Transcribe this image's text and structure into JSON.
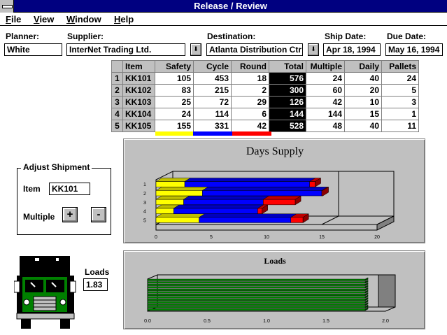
{
  "window": {
    "title": "Release / Review"
  },
  "menu": [
    "File",
    "View",
    "Window",
    "Help"
  ],
  "form": {
    "planner_label": "Planner:",
    "planner_value": "White",
    "supplier_label": "Supplier:",
    "supplier_value": "InterNet Trading Ltd.",
    "destination_label": "Destination:",
    "destination_value": "Atlanta Distribution Ctr",
    "ship_date_label": "Ship Date:",
    "ship_date_value": "Apr 18, 1994",
    "due_date_label": "Due Date:",
    "due_date_value": "May 16, 1994"
  },
  "table": {
    "columns": [
      "Item",
      "Safety",
      "Cycle",
      "Round",
      "Total",
      "Multiple",
      "Daily",
      "Pallets"
    ],
    "rows": [
      [
        "1",
        "KK101",
        "105",
        "453",
        "18",
        "576",
        "24",
        "40",
        "24"
      ],
      [
        "2",
        "KK102",
        "83",
        "215",
        "2",
        "300",
        "60",
        "20",
        "5"
      ],
      [
        "3",
        "KK103",
        "25",
        "72",
        "29",
        "126",
        "42",
        "10",
        "3"
      ],
      [
        "4",
        "KK104",
        "24",
        "114",
        "6",
        "144",
        "144",
        "15",
        "1"
      ],
      [
        "5",
        "KK105",
        "155",
        "331",
        "42",
        "528",
        "48",
        "40",
        "11"
      ]
    ]
  },
  "adjust": {
    "title": "Adjust Shipment",
    "item_label": "Item",
    "item_value": "KK101",
    "multiple_label": "Multiple",
    "plus": "+",
    "minus": "-"
  },
  "loads": {
    "label": "Loads",
    "value": "1.83"
  },
  "colors": {
    "title_bar": "#000080",
    "safety": "#ffff00",
    "cycle": "#0000ff",
    "round": "#ff0000",
    "panel": "#c0c0c0",
    "truck_cab": "#008000"
  },
  "icons": {
    "combo_arrow": "down-arrow-icon",
    "truck": "truck-icon"
  },
  "chart_data": [
    {
      "type": "bar",
      "orientation": "horizontal",
      "stacked": true,
      "title": "Days Supply",
      "categories": [
        "1",
        "2",
        "3",
        "4",
        "5"
      ],
      "series": [
        {
          "values": [
            2.6,
            4.2,
            2.5,
            1.6,
            3.9
          ]
        },
        {
          "values": [
            11.3,
            10.8,
            7.2,
            7.6,
            8.3
          ]
        },
        {
          "values": [
            0.5,
            0.1,
            2.9,
            0.4,
            1.1
          ]
        }
      ],
      "xlim": [
        0,
        20
      ],
      "xticks": [
        "0",
        "5",
        "10",
        "15",
        "20"
      ],
      "grid": false
    },
    {
      "type": "bar",
      "orientation": "horizontal",
      "title": "Loads",
      "values": [
        1.83
      ],
      "xlim": [
        0,
        2.0
      ],
      "xticks": [
        "0.0",
        "0.5",
        "1.0",
        "1.5",
        "2.0"
      ]
    }
  ]
}
